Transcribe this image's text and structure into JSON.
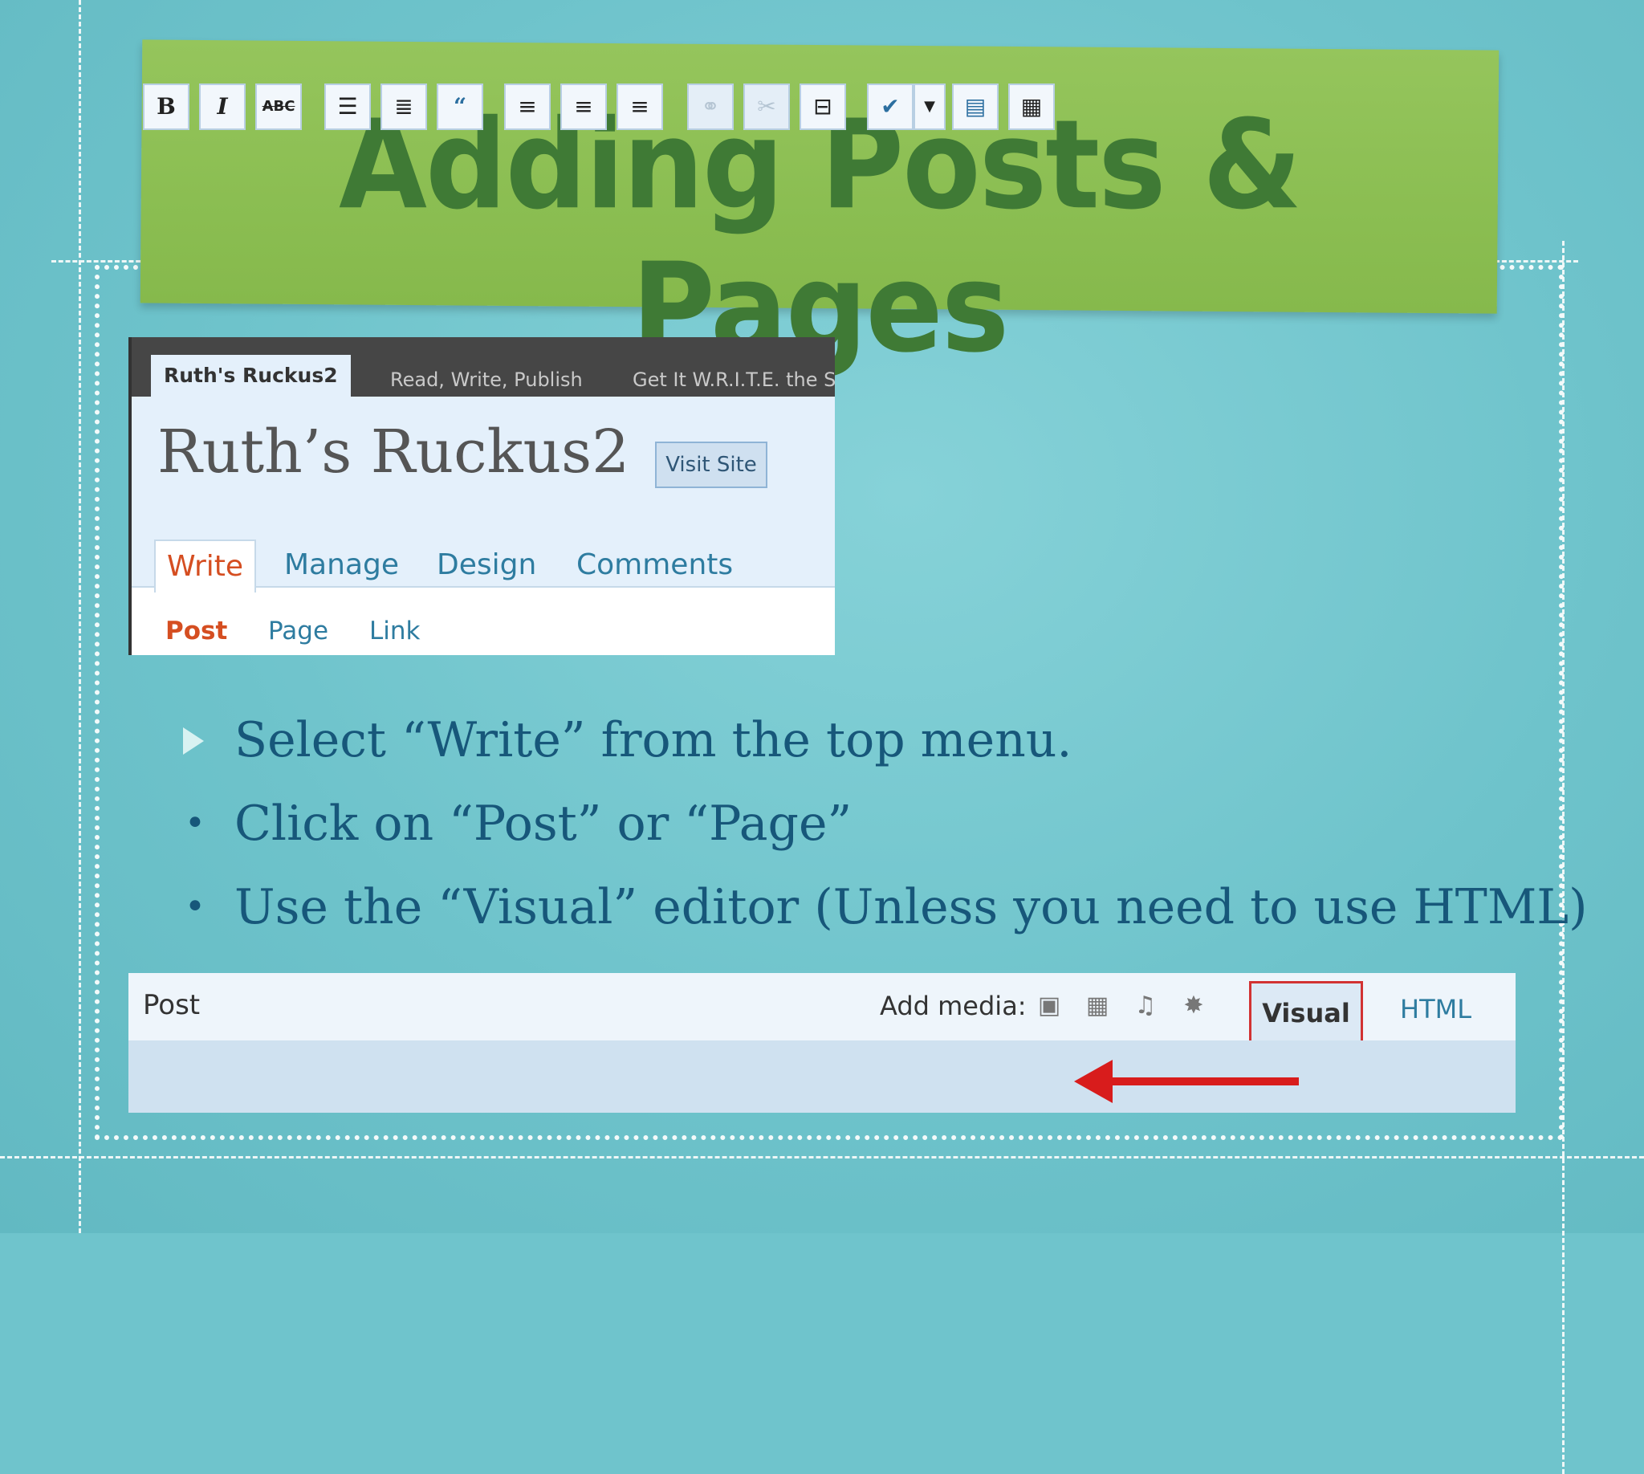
{
  "slide": {
    "title": "Adding Posts & Pages",
    "colors": {
      "background": "#6fc4cc",
      "banner": "#8bbe52",
      "title": "#3f7a35",
      "bullet_text": "#17577a"
    }
  },
  "admin_header": {
    "tabs": [
      "Ruth's Ruckus2",
      "Read, Write, Publish",
      "Get It W.R.I.T.E. the S"
    ],
    "site_title": "Ruth’s Ruckus2",
    "visit_site_label": "Visit Site",
    "menu": [
      "Write",
      "Manage",
      "Design",
      "Comments"
    ],
    "submenu": [
      "Post",
      "Page",
      "Link"
    ]
  },
  "bullets": [
    {
      "marker": "triangle",
      "text": "Select “Write” from the top menu."
    },
    {
      "marker": "•",
      "text": "Click on “Post” or “Page”"
    },
    {
      "marker": "•",
      "text": "Use the “Visual” editor (Unless you need to use HTML)"
    }
  ],
  "editor": {
    "post_label": "Post",
    "add_media_label": "Add media:",
    "media_icons": [
      "image-icon",
      "video-icon",
      "audio-icon",
      "media-icon"
    ],
    "visual_tab": "Visual",
    "html_tab": "HTML",
    "toolbar_icons": [
      "bold-icon",
      "italic-icon",
      "strikethrough-icon",
      "bullet-list-icon",
      "numbered-list-icon",
      "blockquote-icon",
      "align-left-icon",
      "align-center-icon",
      "align-right-icon",
      "link-icon",
      "unlink-icon",
      "more-tag-icon",
      "spellcheck-icon",
      "spellcheck-dropdown-icon",
      "fullscreen-icon",
      "kitchen-sink-icon"
    ],
    "bold_glyph": "B",
    "italic_glyph": "I",
    "strike_glyph": "ABC"
  }
}
